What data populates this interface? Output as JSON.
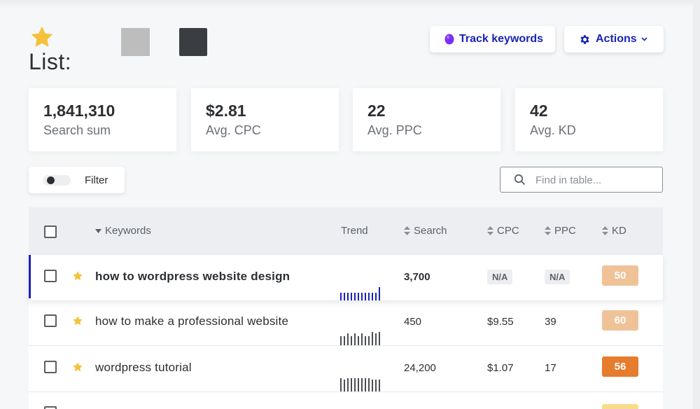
{
  "header": {
    "list_label": "List:",
    "track_keywords_label": "Track keywords",
    "actions_label": "Actions"
  },
  "colors": {
    "accent": "#1a23b5",
    "star": "#f4c23a",
    "track_dot": "#7b2ff7",
    "kd_light": "#f0c298",
    "kd_dark": "#e67c2d",
    "kd_peek": "#f7dc8c"
  },
  "stats": [
    {
      "value": "1,841,310",
      "label": "Search sum"
    },
    {
      "value": "$2.81",
      "label": "Avg. CPC"
    },
    {
      "value": "22",
      "label": "Avg. PPC"
    },
    {
      "value": "42",
      "label": "Avg. KD"
    }
  ],
  "filter": {
    "label": "Filter"
  },
  "search": {
    "placeholder": "Find in table..."
  },
  "table": {
    "headers": {
      "keywords": "Keywords",
      "trend": "Trend",
      "search": "Search",
      "cpc": "CPC",
      "ppc": "PPC",
      "kd": "KD"
    },
    "rows": [
      {
        "keyword": "how to wordpress website design",
        "search": "3,700",
        "cpc": "N/A",
        "ppc": "N/A",
        "kd": "50",
        "kd_color": "#f0c298",
        "trend": [
          0.5,
          0.5,
          0.5,
          0.5,
          0.5,
          0.5,
          0.5,
          0.5,
          0.5,
          0.5,
          0.5,
          0.85
        ],
        "trend_color": "#1a23b5"
      },
      {
        "keyword": "how to make a professional website",
        "search": "450",
        "cpc": "$9.55",
        "ppc": "39",
        "kd": "60",
        "kd_color": "#f0c298",
        "trend": [
          0.6,
          0.6,
          0.75,
          0.6,
          0.75,
          0.6,
          0.75,
          0.6,
          0.6,
          0.85,
          0.75,
          0.85
        ],
        "trend_color": "#4a4d52"
      },
      {
        "keyword": "wordpress tutorial",
        "search": "24,200",
        "cpc": "$1.07",
        "ppc": "17",
        "kd": "56",
        "kd_color": "#e67c2d",
        "trend": [
          0.85,
          0.75,
          0.85,
          0.85,
          0.85,
          0.85,
          0.85,
          0.85,
          0.85,
          0.75,
          0.75,
          0.75
        ],
        "trend_color": "#4a4d52"
      }
    ]
  }
}
